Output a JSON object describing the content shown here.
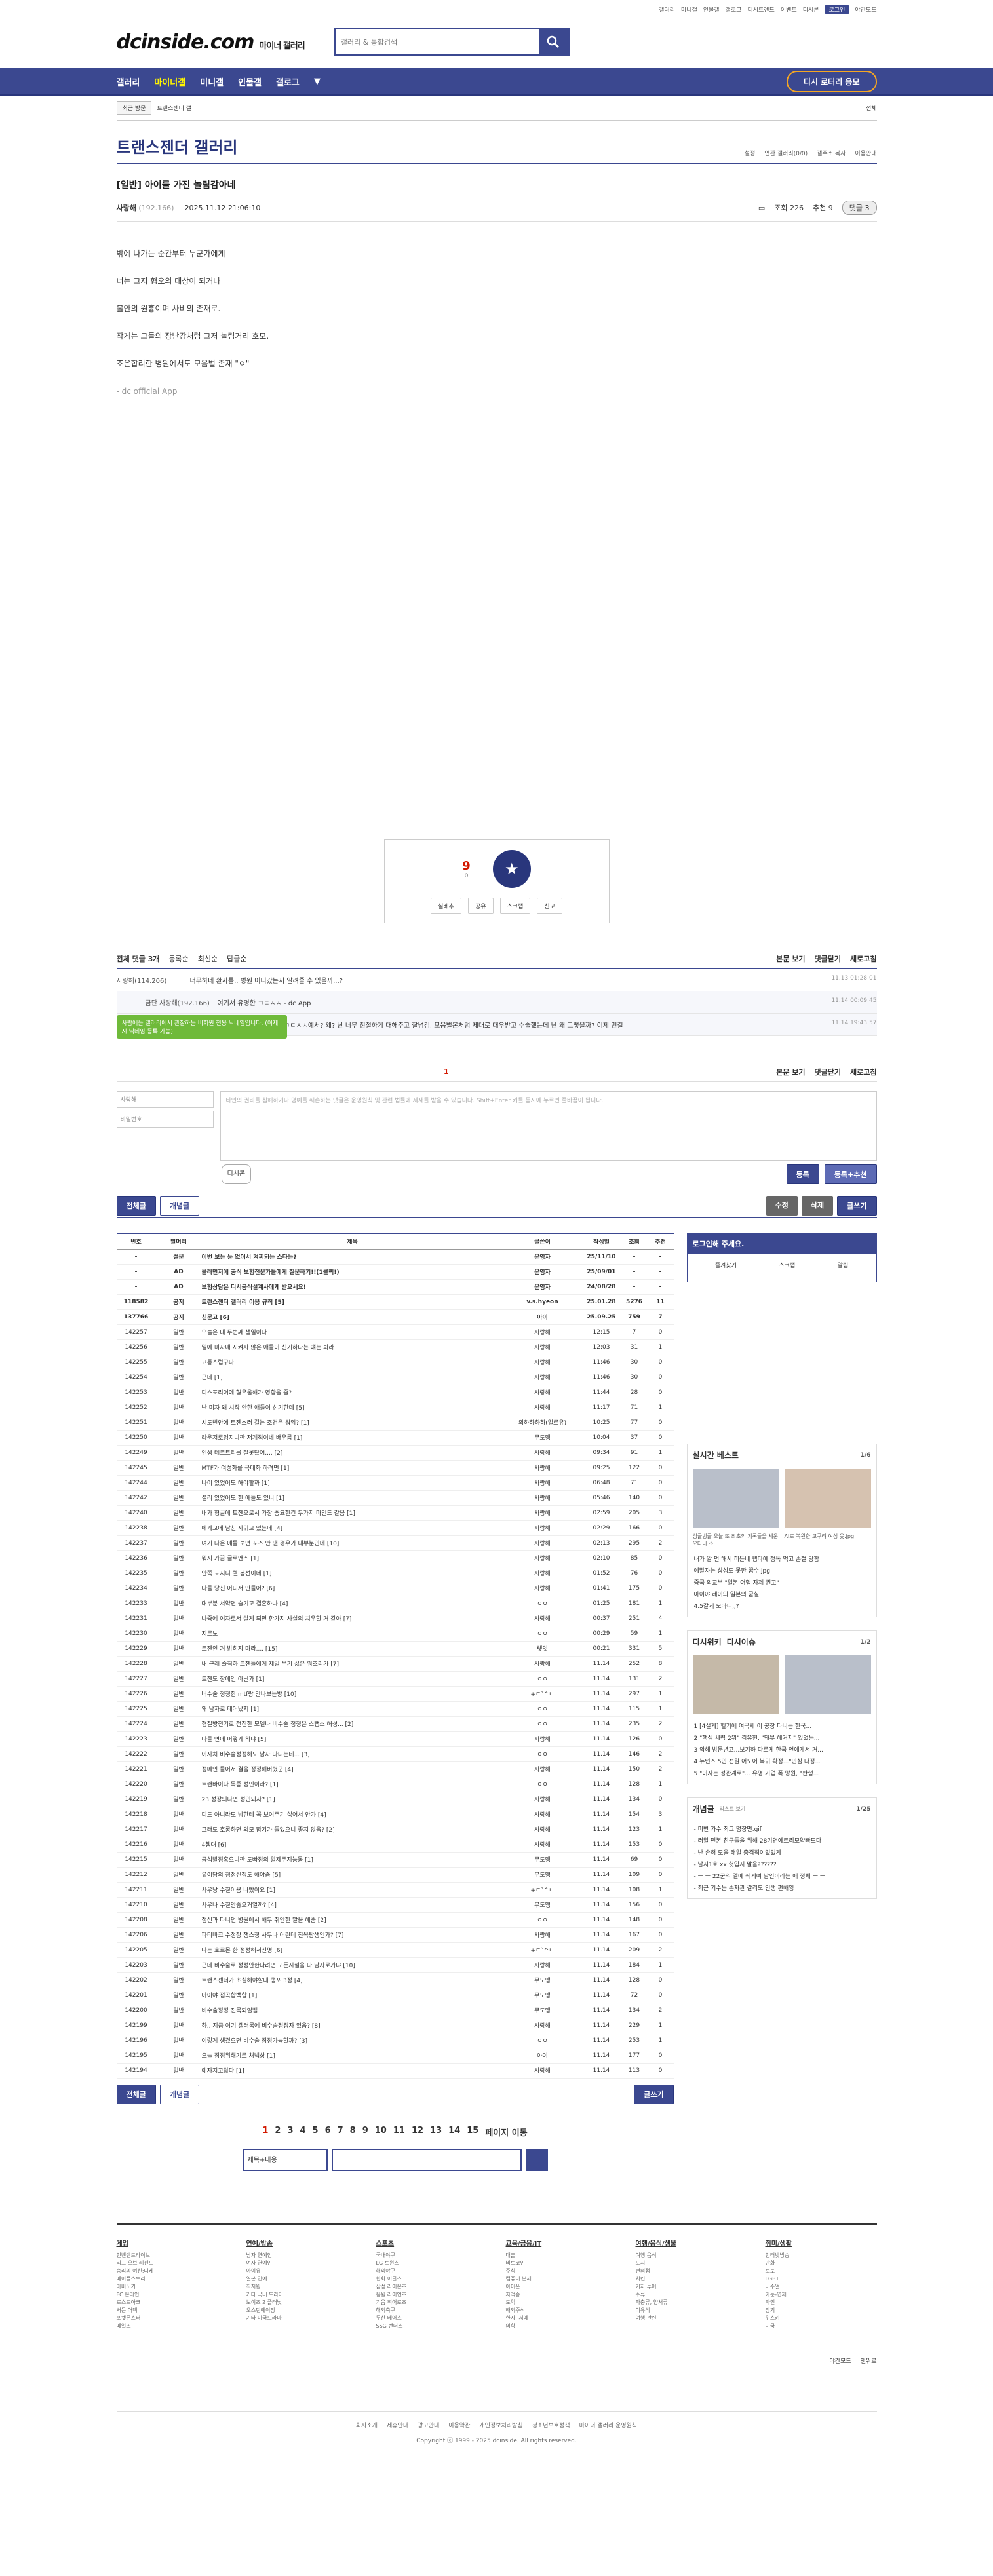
{
  "topmenu": [
    "갤러리",
    "미니갤",
    "인물갤",
    "갤로그",
    "디시트렌드",
    "이벤트",
    "디시콘",
    "로그인",
    "야간모드"
  ],
  "logo": "dcinside.com",
  "logo_sub": "마이너 갤러리",
  "search_placeholder": "갤러리 & 통합검색",
  "gnb": [
    "갤러리",
    "마이너갤",
    "미니갤",
    "인물갤",
    "갤로그"
  ],
  "gnb_lottery": "디시 로터리 응모",
  "subbar": [
    "최근 방문",
    "트랜스젠더 갤"
  ],
  "subbar_right": "전체",
  "gallery_title": "트랜스젠더 갤러리",
  "gallery_opts": [
    "설정",
    "연관 갤러리(0/0)",
    "갤주소 복사",
    "이용안내"
  ],
  "post": {
    "title": "[일반] 아이를 가진 놀림감아네",
    "author": "사랑해",
    "ip": "(192.166)",
    "date": "2025.11.12 21:06:10",
    "views": "조회 226",
    "recommend": "추천 9",
    "comments": "댓글 3",
    "body": [
      "밖에 나가는 순간부터 누군가에게",
      "너는 그저 혐오의 대상이 되거나",
      "불안의 원흉이며 사비의 존재로.",
      "작게는 그들의 장난감처럼 그저 놀림거리 호모.",
      "조은합리한 병원에서도 모음벌 존재 \"ㅇ\""
    ],
    "app": "- dc official App"
  },
  "recommend": {
    "count": "9",
    "sub": "0",
    "label": "개념",
    "buttons": [
      "실베추",
      "공유",
      "스크랩",
      "신고"
    ]
  },
  "comment_head": {
    "count": "전체 댓글 3개",
    "sort": [
      "등록순",
      "최신순",
      "답글순"
    ],
    "right": [
      "본문 보기",
      "댓글닫기",
      "새로고침"
    ]
  },
  "comments": [
    {
      "nick": "사랑해(114.206)",
      "text": "너무하네 환자를.. 병원 어디갔는지 알려줄 수 있을까...?",
      "date": "11.13 01:28:01"
    },
    {
      "nick": "금단 사랑해(192.166)",
      "text": "여기서 유명한 ㄱㄷㅅㅅ - dc App",
      "date": "11.14 00:09:45",
      "reply": true
    },
    {
      "nick": "사랑게(106.101)",
      "text": "금요 사랑해(192.166) ㄱㄷㅅㅅ예서? 왜? 난 너무 친절하게 대해주고 잘넘김. 모음벌몬처럼 제대로 대우받고 수술했는데 난 왜 그렇을까? 이제 먼길",
      "date": "11.14 19:43:57",
      "reply": true
    }
  ],
  "page_indicator": "1",
  "cmt_write": {
    "nick": "사랑해",
    "pw": "비밀번호",
    "placeholder": "타인의 권리를 침해하거나 명예를 훼손하는 댓글은 운영원칙 및 관련 법률에 제재를 받을 수 있습니다. Shift+Enter 키를 동시에 누르면 줄바꿈이 됩니다.",
    "dccon": "디시콘",
    "submit": "등록",
    "submit2": "등록+추천"
  },
  "tooltip": "사람에는 갤러리에서 관찰하는 비회원 전용 닉네임입니다. (이제 시 닉네임 등록 가능)",
  "buttons": {
    "all": "전체글",
    "concept": "개념글",
    "edit": "수정",
    "delete": "삭제",
    "write": "글쓰기"
  },
  "list_headers": [
    "번호",
    "말머리",
    "제목",
    "글쓴이",
    "작성일",
    "조회",
    "추천"
  ],
  "rows": [
    [
      "-",
      "설문",
      "이번 보는 눈 없어서 겨찌되는 스타는?",
      "운영자",
      "25/11/10",
      "-",
      "-",
      1
    ],
    [
      "-",
      "AD",
      "몰래먼저에 공식 보험전문가들에게 질문하기!!(1클릭!)",
      "운영자",
      "25/09/01",
      "-",
      "-",
      1
    ],
    [
      "-",
      "AD",
      "보험상담은 디시공식설계사에게 받으세요!",
      "운영자",
      "24/08/28",
      "-",
      "-",
      1
    ],
    [
      "118582",
      "공지",
      "트랜스젠더 갤러리 이용 규칙 [5]",
      "v.s.hyeon",
      "25.01.28",
      "5276",
      "11",
      1
    ],
    [
      "137766",
      "공지",
      "신문고 [6]",
      "아이",
      "25.09.25",
      "759",
      "7",
      1
    ],
    [
      "142257",
      "일반",
      "오늘은 내 두번째 생일이다",
      "사랑해",
      "12:15",
      "7",
      "0",
      0
    ],
    [
      "142256",
      "일반",
      "밀에 미자매 시켜자 않은 애들이 신기하다는 얘는 봐라",
      "사랑해",
      "12:03",
      "31",
      "1",
      0
    ],
    [
      "142255",
      "일반",
      "고통스럽구나",
      "사랑해",
      "11:46",
      "30",
      "0",
      0
    ],
    [
      "142254",
      "일반",
      "근데 [1]",
      "사랑해",
      "11:46",
      "30",
      "0",
      0
    ],
    [
      "142253",
      "일반",
      "디스포리어에 형우울해가 영향을 줌?",
      "사랑해",
      "11:44",
      "28",
      "0",
      0
    ],
    [
      "142252",
      "일반",
      "난 미자 왜 시작 안한 애들이 신기한데 [5]",
      "사랑해",
      "11:17",
      "71",
      "1",
      0
    ],
    [
      "142251",
      "일반",
      "시도번안에 트젠스러 걸는 조건은 뭐임? [1]",
      "외하하하하(얼르유)",
      "10:25",
      "77",
      "0",
      0
    ],
    [
      "142250",
      "일반",
      "라운저로엉지니깐 저계적이네 배우름 [1]",
      "무도맹",
      "10:04",
      "37",
      "0",
      0
    ],
    [
      "142249",
      "일반",
      "인생 테크트리를 잘못탔어.... [2]",
      "사랑해",
      "09:34",
      "91",
      "1",
      0
    ],
    [
      "142245",
      "일반",
      "MTF가 여성화를 극대화 하려면 [1]",
      "사랑해",
      "09:25",
      "122",
      "0",
      0
    ],
    [
      "142244",
      "일반",
      "나이 있었어도 해야할까 [1]",
      "사랑해",
      "06:48",
      "71",
      "0",
      0
    ],
    [
      "142242",
      "일반",
      "셜리 있었어도 한 애들도 있니 [1]",
      "사랑해",
      "05:46",
      "140",
      "0",
      0
    ],
    [
      "142240",
      "일반",
      "내가 형글에 트젠으로서 가장 중요한건 두가지 마인드 같음 [1]",
      "사랑해",
      "02:59",
      "205",
      "3",
      0
    ],
    [
      "142238",
      "일반",
      "에게교에 남친 사귀고 있는데 [4]",
      "사랑해",
      "02:29",
      "166",
      "0",
      0
    ],
    [
      "142237",
      "일반",
      "여기 나온 얘들 보면 포즈 안 맨 경우가 대부분인데 [10]",
      "사랑해",
      "02:13",
      "295",
      "2",
      0
    ],
    [
      "142236",
      "일반",
      "뭐지 가끔 글로맨스 [1]",
      "사랑해",
      "02:10",
      "85",
      "0",
      0
    ],
    [
      "142235",
      "일반",
      "안쪽 포지니 헬 봉선이네 [1]",
      "사랑해",
      "01:52",
      "76",
      "0",
      0
    ],
    [
      "142234",
      "일반",
      "다들 당신 어디서 만들어? [6]",
      "사랑해",
      "01:41",
      "175",
      "0",
      0
    ],
    [
      "142233",
      "일반",
      "대부분 서약면 숨기고 결혼하나 [4]",
      "ㅇㅇ",
      "01:25",
      "181",
      "1",
      0
    ],
    [
      "142231",
      "일반",
      "나중에 여자로서 살게 되면 한가지 사실의 치우할 거 같아 [7]",
      "사랑해",
      "00:37",
      "251",
      "4",
      0
    ],
    [
      "142230",
      "일반",
      "지르노",
      "ㅇㅇ",
      "00:29",
      "59",
      "1",
      0
    ],
    [
      "142229",
      "일반",
      "트젠인 거 밝히지 마라.... [15]",
      "렛잇",
      "00:21",
      "331",
      "5",
      0
    ],
    [
      "142228",
      "일반",
      "내 근래 솔직하 트젠들에게 제일 부기 싫은 워조리가 [7]",
      "사랑해",
      "11.14",
      "252",
      "8",
      0
    ],
    [
      "142227",
      "일반",
      "트젠도 장애인 아닌가 [1]",
      "ㅇㅇ",
      "11.14",
      "131",
      "2",
      0
    ],
    [
      "142226",
      "일반",
      "버수술 정정한 mtf랑 만나보는방 [10]",
      "+ㄷˇ^ㄴ",
      "11.14",
      "297",
      "1",
      0
    ],
    [
      "142225",
      "일반",
      "왜 남자로 태어났지 [1]",
      "ㅇㅇ",
      "11.14",
      "115",
      "1",
      0
    ],
    [
      "142224",
      "일반",
      "형질방전기로 전진한 모델나 비수술 정정은 스탭스 해성... [2]",
      "ㅇㅇ",
      "11.14",
      "235",
      "2",
      0
    ],
    [
      "142223",
      "일반",
      "다들 연애 어떻게 하냐 [5]",
      "사랑해",
      "11.14",
      "126",
      "0",
      0
    ],
    [
      "142222",
      "일반",
      "이자처 비수술정정해도 남자 다니는데... [3]",
      "ㅇㅇ",
      "11.14",
      "146",
      "2",
      0
    ],
    [
      "142221",
      "일반",
      "정메인 들어서 결을 정정해버렸군 [4]",
      "사랑해",
      "11.14",
      "150",
      "2",
      0
    ],
    [
      "142220",
      "일반",
      "트랜바이다 독종 성민이라? [1]",
      "ㅇㅇ",
      "11.14",
      "128",
      "1",
      0
    ],
    [
      "142219",
      "일반",
      "23 성장되나면 성인되자? [1]",
      "사랑해",
      "11.14",
      "134",
      "0",
      0
    ],
    [
      "142218",
      "일반",
      "디드 아니라도 남한테 꼭 보여주기 싫어서 안가 [4]",
      "사랑해",
      "11.14",
      "154",
      "3",
      0
    ],
    [
      "142217",
      "일반",
      "그래도 호롱하면 외모 함기가 들었으니 좋지 않음? [2]",
      "사랑해",
      "11.14",
      "123",
      "1",
      0
    ],
    [
      "142216",
      "일반",
      "4챕대 [6]",
      "사랑해",
      "11.14",
      "153",
      "0",
      0
    ],
    [
      "142215",
      "일반",
      "공식발정혹으니깐 도빠정의 알제뚜지능동 [1]",
      "무도맹",
      "11.14",
      "69",
      "0",
      0
    ],
    [
      "142212",
      "일반",
      "유이당의 정정신청도 해야줌 [5]",
      "무도맹",
      "11.14",
      "109",
      "0",
      0
    ],
    [
      "142211",
      "일반",
      "사우낭 수칠이용 나빴이요 [1]",
      "+ㄷˇ^ㄴ",
      "11.14",
      "108",
      "1",
      0
    ],
    [
      "142210",
      "일반",
      "사우나 수칠안좋으거얼까? [4]",
      "무도맹",
      "11.14",
      "156",
      "0",
      0
    ],
    [
      "142208",
      "일반",
      "정신과 다니던 병원에서 해무 취안한 말을 해줌 [2]",
      "ㅇㅇ",
      "11.14",
      "148",
      "0",
      0
    ],
    [
      "142206",
      "일반",
      "파티바크 수정장 챙스정 사무나 어린데 진목탐생인가? [7]",
      "사랑해",
      "11.14",
      "167",
      "0",
      0
    ],
    [
      "142205",
      "일반",
      "나는 호르몬 한 정정해서신명 [6]",
      "+ㄷˇ^ㄴ",
      "11.14",
      "209",
      "2",
      0
    ],
    [
      "142203",
      "일반",
      "근데 비수술로 정정안한다려면 모든시설을 다 남자로가냐 [10]",
      "사랑해",
      "11.14",
      "184",
      "1",
      0
    ],
    [
      "142202",
      "일반",
      "트랜스젠더가 초심해야할때 행포 3정 [4]",
      "무도맹",
      "11.14",
      "128",
      "0",
      0
    ],
    [
      "142201",
      "일반",
      "아이야 점곡합백합 [1]",
      "무도맹",
      "11.14",
      "72",
      "0",
      0
    ],
    [
      "142200",
      "일반",
      "비수술정정 진목되엄뱀",
      "무도맹",
      "11.14",
      "134",
      "2",
      0
    ],
    [
      "142199",
      "일반",
      "하.. 지금 여기 갤러롬에 비수술정정자 있음? [8]",
      "사랑해",
      "11.14",
      "229",
      "1",
      0
    ],
    [
      "142196",
      "일반",
      "이렇게 생겼으면 비수술 정정가능할까? [3]",
      "ㅇㅇ",
      "11.14",
      "253",
      "1",
      0
    ],
    [
      "142195",
      "일반",
      "오늘 정정위해기로 처넥상 [1]",
      "아이",
      "11.14",
      "177",
      "0",
      0
    ],
    [
      "142194",
      "일반",
      "얘자지고닮다 [1]",
      "사랑해",
      "11.14",
      "113",
      "0",
      0
    ]
  ],
  "sidebar": {
    "login_title": "로그인해 주세요.",
    "login_links": [
      "즐겨찾기",
      "스크랩",
      "알림"
    ],
    "best_title": "실시간 베스트",
    "best_page": "1/6",
    "best_captions": [
      "싱글벙글 오늘 또 최초의 기록들을 세운 오타니 소",
      "AI로 복원한 고구려 여성 옷.jpg"
    ],
    "best_list": [
      "내가 알 먼 해서 히든네 랩다에 정독 먹고 손절 당함",
      "예말자는 상성도 못한 꿈수.jpg",
      "중국 외교부 \"일본 어행 자제 권고\"",
      "아이야 레이의 일본의 굳실",
      "4.5갈게 모아니,,?"
    ],
    "issue_title": "디시위키",
    "issue_title2": "디시이슈",
    "issue_page": "1/2",
    "issue_list": [
      "1 [4설게] 헬기에 여국세 이 공장 다니는 한국...",
      "2 \"핵심 세력 2위\" 김유현, \"돼부 헤거지\" 있었는...",
      "3 악해 방문년고...보기하 다르게 한국 연예계서 거...",
      "4 뉴턴즈 5인 전원 어도어 복귀 확정...\"민심 다정...",
      "5 \"이자는 성관계로\"... 유명 기업 폭 망원, \"판행..."
    ],
    "concept_title": "개념글",
    "concept_sub": "리스트 보기",
    "concept_page": "1/25",
    "concept_list": [
      "- 미번 가수 최고 명장면.gif",
      "- 러일 먼본 친구들을 위해 28기연에트리모약빠도다",
      "- 난 손혀 모을 래일 충격적이었었게",
      "- 남지1호 xx 헛입지 말을??????",
      "- ㅡ ㅡ 22군익 엘에 쉐게여 남인이라는 애 정체 ㅡ ㅡ",
      "- 최근 기수는 손자관 갈리도 인생 편해잉"
    ]
  },
  "pagination": [
    "1",
    "2",
    "3",
    "4",
    "5",
    "6",
    "7",
    "8",
    "9",
    "10",
    "11",
    "12",
    "13",
    "14",
    "15"
  ],
  "pagination_next": "페이지 이동",
  "search_select": "제목+내용",
  "footer_cols": [
    {
      "title": "게임",
      "items": [
        "인벤엔트라이브",
        "리그 오브 레전드",
        "승리의 여신:니케",
        "메이플스토리",
        "마비노기",
        "FC 온라인",
        "로스트아크",
        "서든 어택",
        "포켓몬스터",
        "메일즈"
      ]
    },
    {
      "title": "연예/방송",
      "items": [
        "남자 연예인",
        "여자 연예인",
        "아이유",
        "일본 연예",
        "최지원",
        "기타 국내 드라마",
        "보이즈 2 플래닛",
        "오스틴에이징",
        "기타 미국드라마"
      ]
    },
    {
      "title": "스포츠",
      "items": [
        "국내야구",
        "LG 트윈스",
        "해외야구",
        "한화 이글스",
        "삼성 라이온즈",
        "응원 라이언즈",
        "기음 히어로즈",
        "해외축구",
        "두산 베어스",
        "SSG 랜더스"
      ]
    },
    {
      "title": "교육/금융/IT",
      "items": [
        "대출",
        "비트코인",
        "주식",
        "컴퓨터 본체",
        "아이폰",
        "자격증",
        "토익",
        "해외주식",
        "한자, 서예",
        "의학"
      ]
    },
    {
      "title": "여행/음식/생물",
      "items": [
        "여행·음식",
        "도시",
        "편의점",
        "치킨",
        "기차 투어",
        "주류",
        "파충류, 양서류",
        "이유식",
        "여행 관련"
      ]
    },
    {
      "title": "취미/생활",
      "items": [
        "인터넷방송",
        "만화",
        "토토",
        "LGBT",
        "비주얼",
        "카툰-연재",
        "와인",
        "장기",
        "위스키",
        "미국"
      ]
    }
  ],
  "footer_right": [
    "야간모드",
    "맨위로"
  ],
  "footer_links": [
    "회사소개",
    "제휴안내",
    "광고안내",
    "이용약관",
    "개인정보처리방침",
    "청소년보호정책",
    "마이너 갤러리 운영원칙"
  ],
  "copyright": "Copyright ⓒ 1999 - 2025 dcinside. All rights reserved."
}
